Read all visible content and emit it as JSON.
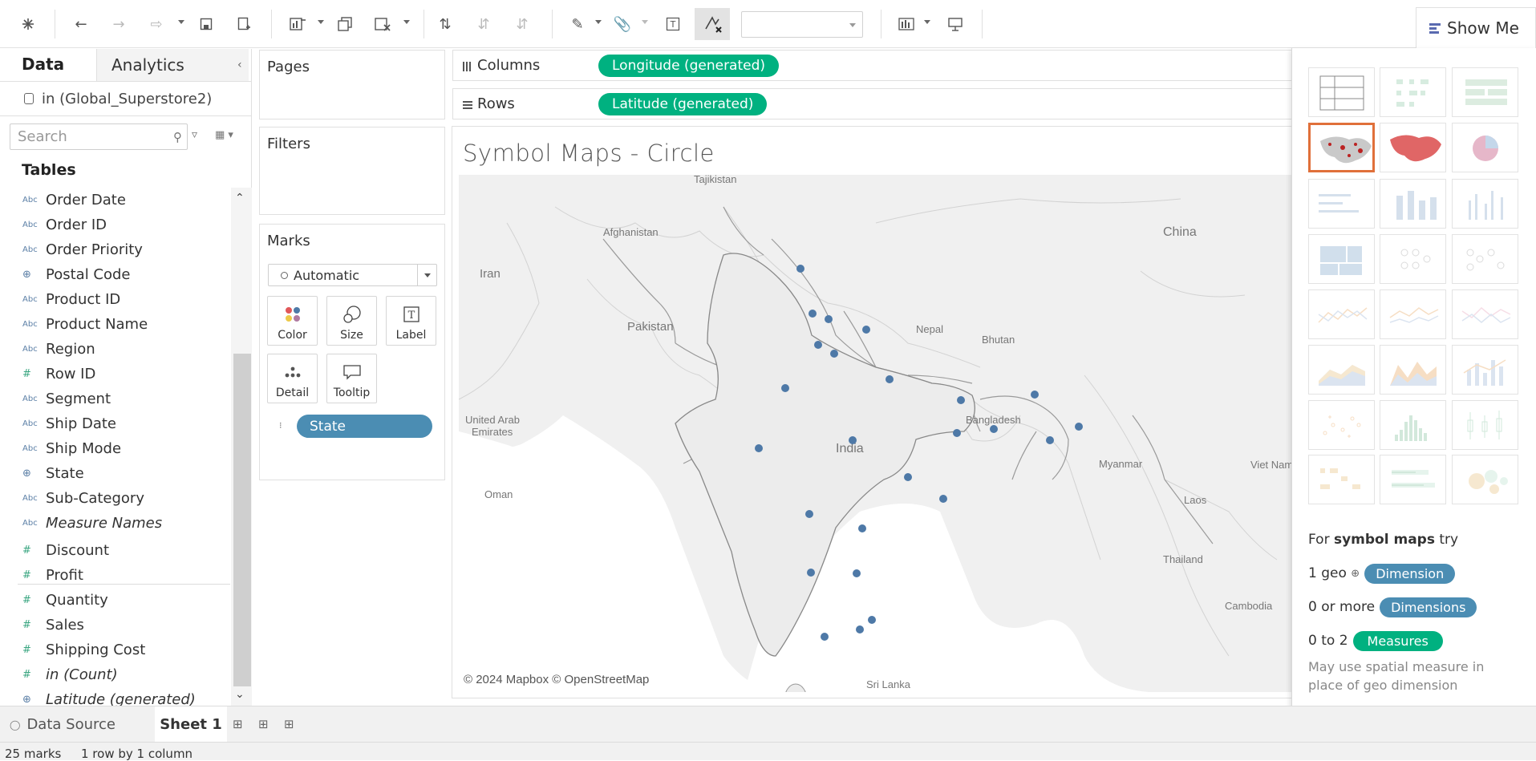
{
  "toolbar": {
    "show_me_label": "Show Me"
  },
  "data_pane": {
    "tabs": [
      "Data",
      "Analytics"
    ],
    "datasource": "in (Global_Superstore2)",
    "search_placeholder": "Search",
    "tables_title": "Tables",
    "fields": [
      {
        "type": "Abc",
        "name": "Order Date"
      },
      {
        "type": "Abc",
        "name": "Order ID"
      },
      {
        "type": "Abc",
        "name": "Order Priority"
      },
      {
        "type": "geo",
        "name": "Postal Code"
      },
      {
        "type": "Abc",
        "name": "Product ID"
      },
      {
        "type": "Abc",
        "name": "Product Name"
      },
      {
        "type": "Abc",
        "name": "Region"
      },
      {
        "type": "#",
        "name": "Row ID"
      },
      {
        "type": "Abc",
        "name": "Segment"
      },
      {
        "type": "Abc",
        "name": "Ship Date"
      },
      {
        "type": "Abc",
        "name": "Ship Mode"
      },
      {
        "type": "geo",
        "name": "State"
      },
      {
        "type": "Abc",
        "name": "Sub-Category"
      },
      {
        "type": "Abc",
        "name": "Measure Names",
        "italic": true
      },
      {
        "type": "#",
        "name": "Discount"
      },
      {
        "type": "#",
        "name": "Profit"
      },
      {
        "type": "#",
        "name": "Quantity"
      },
      {
        "type": "#",
        "name": "Sales"
      },
      {
        "type": "#",
        "name": "Shipping Cost"
      },
      {
        "type": "#",
        "name": "in (Count)",
        "italic": true
      },
      {
        "type": "geo",
        "name": "Latitude (generated)",
        "italic": true
      }
    ]
  },
  "cards": {
    "pages": "Pages",
    "filters": "Filters",
    "marks": "Marks",
    "mark_type": "Automatic",
    "mark_buttons": [
      "Color",
      "Size",
      "Label",
      "Detail",
      "Tooltip"
    ],
    "detail_pill": "State"
  },
  "shelves": {
    "columns_label": "Columns",
    "columns_pill": "Longitude (generated)",
    "rows_label": "Rows",
    "rows_pill": "Latitude (generated)"
  },
  "view": {
    "title": "Symbol  Maps - Circle",
    "credit": "© 2024 Mapbox © OpenStreetMap",
    "map_labels": [
      "Tajikistan",
      "Afghanistan",
      "Iran",
      "China",
      "Pakistan",
      "Nepal",
      "Bhutan",
      "United Arab\nEmirates",
      "India",
      "Bangladesh",
      "Myanmar",
      "Oman",
      "Viet Nam",
      "Laos",
      "Thailand",
      "Cambodia",
      "Sri Lanka"
    ],
    "marks_color": "#4e79a7"
  },
  "show_me": {
    "help_lead": "For ",
    "help_bold": "symbol maps",
    "help_tail": " try",
    "req1_text": "1 geo",
    "req1_pill": "Dimension",
    "req2_text": "0 or more",
    "req2_pill": "Dimensions",
    "req3_text": "0 to 2",
    "req3_pill": "Measures",
    "note": "May use spatial measure in place of geo dimension"
  },
  "bottom": {
    "data_source_tab": "Data Source",
    "sheet_tab": "Sheet 1",
    "status_marks": "25 marks",
    "status_dims": "1 row by 1 column"
  },
  "colors": {
    "accent_green": "#00b180",
    "dimension_blue": "#4b8db3",
    "selected_orange": "#e0703a"
  }
}
